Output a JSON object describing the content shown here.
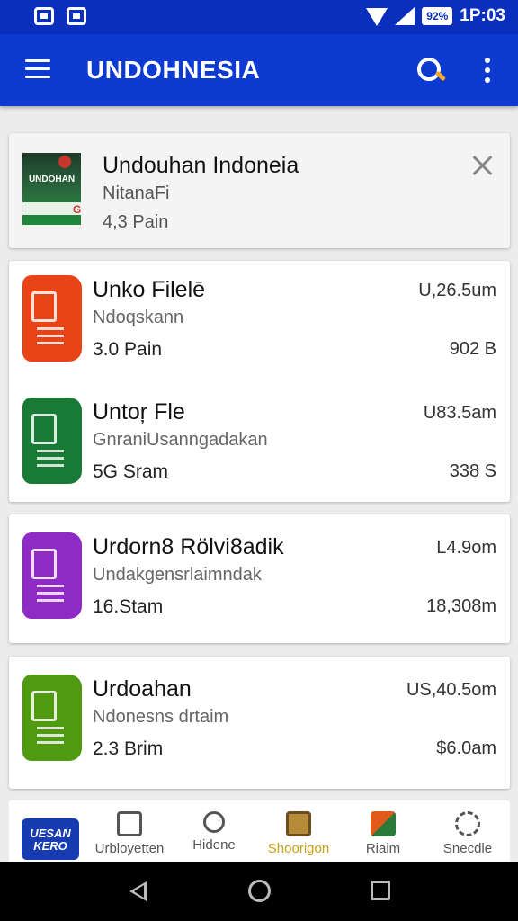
{
  "statusbar": {
    "time": "1P:03",
    "battery": "92%",
    "colors": {
      "bar": "#0a2fbd"
    }
  },
  "appbar": {
    "title": "UNDOHNESIA",
    "icons": [
      "menu-icon",
      "search-icon",
      "more-icon"
    ],
    "color": "#0d3ad0"
  },
  "notification": {
    "title": "Undouhan Indoneia",
    "subtitle": "NitanaFi",
    "meta": "4,3 Pain",
    "thumb_label": "UNDOHAN",
    "thumb_mark": "G"
  },
  "apps": [
    {
      "name": "Unko Filelē",
      "developer": "Ndoqskann",
      "meta": "3.0 Pain",
      "size": "U,26.5um",
      "size2": "902 B",
      "icon_color": "#e84418",
      "icon_name": "document-icon"
    },
    {
      "name": "Untoŗ Fle",
      "developer": "GnraniUsanngadakan",
      "meta": "5G Sram",
      "size": "U83.5am",
      "size2": "338 S",
      "icon_color": "#197a35",
      "icon_name": "leaf-document-icon"
    },
    {
      "name": "Urdorn8 Rölvi8adik",
      "developer": "Undakgensrlaimndak",
      "meta": "16.Stam",
      "size": "L4.9om",
      "size2": "18,308m",
      "icon_color": "#8e2bc4",
      "icon_name": "note-document-icon"
    },
    {
      "name": "Urdoahan",
      "developer": "Ndonesns drtaim",
      "meta": "2.3 Brim",
      "size": "US,40.5om",
      "size2": "$6.0am",
      "icon_color": "#4f9a10",
      "icon_name": "file-document-icon"
    }
  ],
  "bottomnav": {
    "brand": "UESAN KERO",
    "items": [
      {
        "label": "Urbloyetten",
        "icon": "shop-icon"
      },
      {
        "label": "Hidene",
        "icon": "search-icon"
      },
      {
        "label": "Shoorigon",
        "icon": "apps-icon",
        "active": true
      },
      {
        "label": "Riaim",
        "icon": "games-icon"
      },
      {
        "label": "Snecdle",
        "icon": "settings-icon"
      }
    ],
    "active_color": "#c8a215"
  }
}
